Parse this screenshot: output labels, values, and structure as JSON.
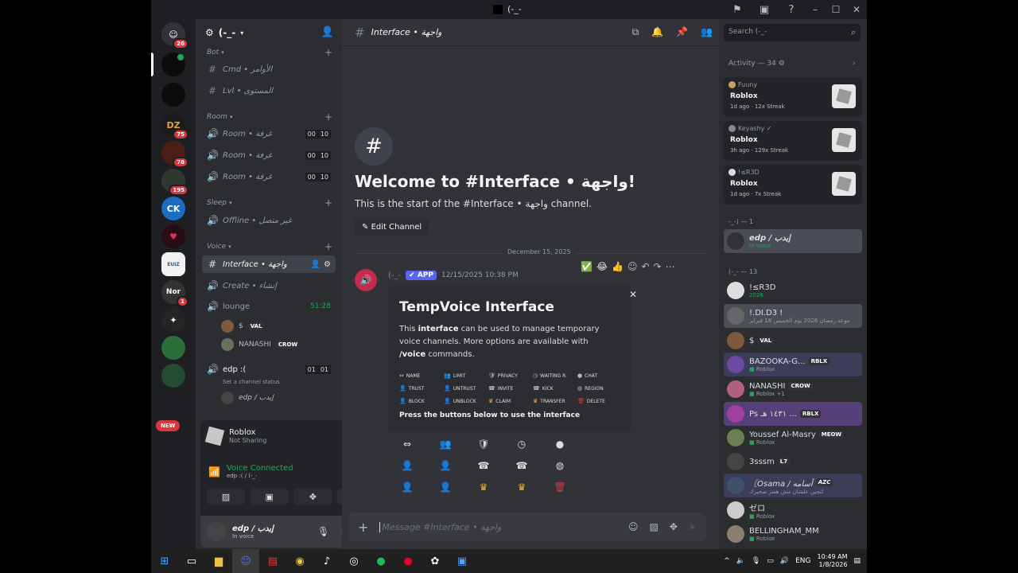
{
  "titlebar": {
    "title": "(-_-",
    "icons": [
      "flag-icon",
      "inbox-icon",
      "help-icon"
    ],
    "minimize": "–",
    "maximize": "☐",
    "close": "✕"
  },
  "servers": [
    {
      "label": "",
      "badge": "26",
      "color": "#313338"
    },
    {
      "label": "",
      "badge": "",
      "color": "#0c0c0c"
    },
    {
      "label": "",
      "badge": "",
      "color": "#0c0c0c"
    },
    {
      "label": "DZ",
      "badge": "75",
      "color": "#1b1b1b"
    },
    {
      "label": "",
      "badge": "78",
      "color": "#4a1d16"
    },
    {
      "label": "",
      "badge": "195",
      "color": "#2e3a30"
    },
    {
      "label": "CK",
      "badge": "",
      "color": "#1c6cc2"
    },
    {
      "label": "",
      "badge": "",
      "color": "#2a0c14"
    },
    {
      "label": "EUIZ",
      "badge": "",
      "color": "#f2f2f2"
    },
    {
      "label": "Nor",
      "badge": "1",
      "color": "#333"
    },
    {
      "label": "",
      "badge": "",
      "color": "#252525"
    },
    {
      "label": "",
      "badge": "",
      "color": "#2b6e3c"
    },
    {
      "label": "",
      "badge": "",
      "color": "#254c33"
    }
  ],
  "new_badge": "NEW",
  "guild": {
    "name": "(-_-"
  },
  "categories": {
    "bot": "Bot",
    "room": "Room",
    "sleep": "Sleep",
    "voice": "Voice"
  },
  "channels": {
    "cmd": "Cmd • الأوامر",
    "lvl": "Lvl • المستوى",
    "room1": "Room • غرفة",
    "room2": "Room • غرفة",
    "room3": "Room • غرفة",
    "room_count_a": "00",
    "room_count_b": "10",
    "offline": "Offline • غير متصل",
    "interface": "Interface • واجهة",
    "create": "Create • إنشاء",
    "lounge": "lounge",
    "lounge_timer": "51:28",
    "edp": "edp :(",
    "edp_count_a": "01",
    "edp_count_b": "01",
    "edp_status": "Set a channel status"
  },
  "lounge_users": [
    {
      "name": "$",
      "tag": "VAL"
    },
    {
      "name": "NANASHI",
      "tag": "CROW"
    }
  ],
  "edp_user": {
    "name": "edp / إيدب"
  },
  "activity_panel": {
    "game": "Roblox",
    "sharing": "Not Sharing",
    "voice_title": "Voice Connected",
    "voice_sub": "edp :( / (-_-"
  },
  "user_panel": {
    "name": "edp / إيدب",
    "status": "In voice"
  },
  "main": {
    "channel_title": "Interface • واجهة",
    "welcome_title": "Welcome to #Interface • واجهة!",
    "welcome_sub": "This is the start of the #Interface • واجهة channel.",
    "edit_button": "Edit Channel",
    "date": "December 15, 2025",
    "msg_author": "(-_-",
    "app_tag": "APP",
    "msg_time": "12/15/2025 10:38 PM",
    "reactions": [
      "✅",
      "😂",
      "👍"
    ],
    "embed": {
      "title": "TempVoice Interface",
      "desc_pre": "This ",
      "desc_bold": "interface",
      "desc_mid": " can be used to manage temporary voice channels. More options are available with ",
      "desc_cmd": "/voice",
      "desc_post": " commands.",
      "footer": "Press the buttons below to use the interface",
      "grid": [
        [
          "NAME",
          "LIMIT",
          "PRIVACY",
          "WAITING R.",
          "CHAT"
        ],
        [
          "TRUST",
          "UNTRUST",
          "INVITE",
          "KICK",
          "REGION"
        ],
        [
          "BLOCK",
          "UNBLOCK",
          "CLAIM",
          "TRANSFER",
          "DELETE"
        ]
      ]
    },
    "composer_placeholder": "Message #Interface • واجهة"
  },
  "members": {
    "search_placeholder": "Search (-_-",
    "activity_header": "Activity — 34",
    "activities": [
      {
        "user": "Fuuny",
        "game": "Roblox",
        "streak": "1d ago  ·  12x Streak"
      },
      {
        "user": "Keyashy ✓",
        "game": "Roblox",
        "streak": "3h ago  ·  129x Streak"
      },
      {
        "user": "!≤R3D",
        "game": "Roblox",
        "streak": "1d ago  ·  7x Streak"
      }
    ],
    "group1": "-_-) — 1",
    "group1_members": [
      {
        "name": "edp / إيدب",
        "status": "In voice"
      }
    ],
    "group2": "(-_- — 13",
    "group2_members": [
      {
        "name": "!≤R3D",
        "status": "2026",
        "tag": ""
      },
      {
        "name": "!.DI.D3 !",
        "status": "موعد رمضان 2026 يوم الخميس 18 فبراير",
        "tag": ""
      },
      {
        "name": "$",
        "status": "",
        "tag": "VAL"
      },
      {
        "name": "BAZOOKA-G...",
        "status": "Roblox",
        "tag": "RBLX"
      },
      {
        "name": "NANASHI",
        "status": "Roblox +1",
        "tag": "CROW"
      },
      {
        "name": "Ps ١٤٣١ هـ ...",
        "status": "",
        "tag": "RBLX"
      },
      {
        "name": "Youssef Al-Masry",
        "status": "Roblox",
        "tag": "MEOW"
      },
      {
        "name": "3sssm",
        "status": "",
        "tag": "L7"
      },
      {
        "name": "〖Osama / أسامه",
        "status": "لتجين علشان مش هعتز صحيرك",
        "tag": "AZC"
      },
      {
        "name": "ゼロ",
        "status": "Roblox",
        "tag": ""
      },
      {
        "name": "BELLINGHAM_MM",
        "status": "Roblox",
        "tag": ""
      }
    ]
  },
  "taskbar": {
    "lang": "ENG",
    "time": "10:49 AM",
    "date": "1/8/2026"
  }
}
